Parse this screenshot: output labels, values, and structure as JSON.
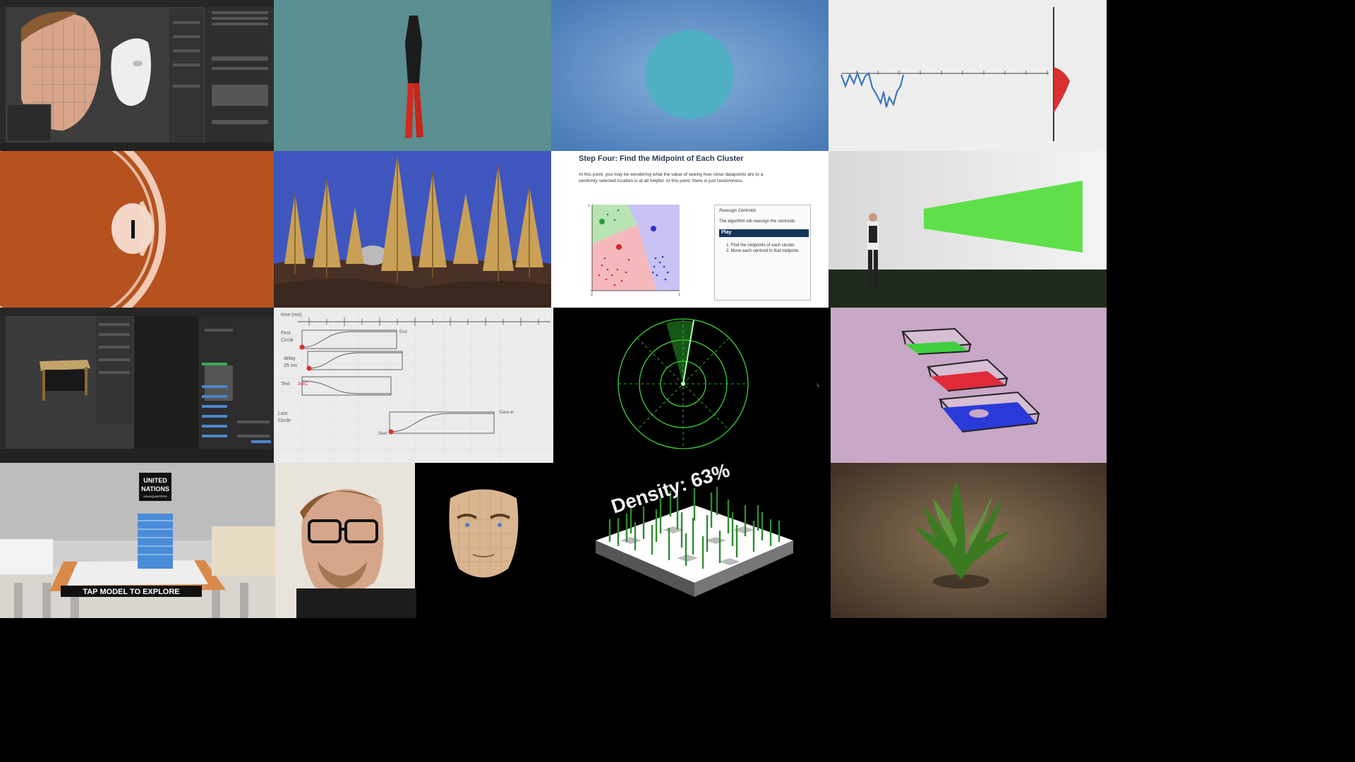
{
  "tiles": [
    {
      "id": "blender-face",
      "kind": "blender editor"
    },
    {
      "id": "pliers",
      "kind": "3d render"
    },
    {
      "id": "blue-circle",
      "kind": "render"
    },
    {
      "id": "line-plot",
      "kind": "plot"
    },
    {
      "id": "eye-diagram",
      "kind": "illustration"
    },
    {
      "id": "forest",
      "kind": "3d render"
    },
    {
      "id": "kmeans",
      "kind": "article"
    },
    {
      "id": "person-cone",
      "kind": "3d render"
    },
    {
      "id": "blender-table",
      "kind": "blender editor"
    },
    {
      "id": "sketch",
      "kind": "hand drawn animation timing sketch"
    },
    {
      "id": "radar",
      "kind": "render"
    },
    {
      "id": "glass-layers",
      "kind": "3d render"
    },
    {
      "id": "un-model",
      "kind": "ar render"
    },
    {
      "id": "selfie-face",
      "kind": "photo"
    },
    {
      "id": "density",
      "kind": "3d render"
    },
    {
      "id": "plant",
      "kind": "3d render"
    }
  ],
  "kmeans": {
    "heading": "Step Four: Find the Midpoint of Each Cluster",
    "paragraph_line1": "At this point, you may be wondering what the value of seeing how close datapoints are to a",
    "paragraph_line2": "randomly selected location is at all helpful. At this point, there is just randomness.",
    "panel_title": "Reassign Centroids",
    "panel_text": "The algorithm will reassign the centroids.",
    "play_label": "Play",
    "step1": "1. Find the midpoints of each cluster.",
    "step2": "2. Move each centroid to that midpoint.",
    "axis_zero": "0",
    "axis_one_x": "1",
    "axis_one_y": "1"
  },
  "un": {
    "sign_line1": "UNITED",
    "sign_line2": "NATIONS",
    "sign_line3": "HEADQUARTERS",
    "banner": "TAP MODEL TO EXPLORE"
  },
  "density": {
    "label": "Density: 63%"
  },
  "sketch": {
    "label_first": "First",
    "label_circle": "Circle",
    "label_delay": "delay",
    "label_delay_ms": "25 ms",
    "label_text": "Text",
    "label_abc": "ABC",
    "label_last": "Last",
    "label_last_circle": "Circle",
    "label_ease": "Ease-in",
    "label_end": "End",
    "label_start": "Start",
    "label_time": "time (ms)"
  },
  "colors": {
    "teal_bg": "#5b8f91",
    "blue_bg": "#4a7bb8",
    "circle": "#4fb0c4",
    "eye_bg": "#b5521f",
    "forest_sky": "#3f56bf",
    "cone_green": "#5fe04a",
    "radar_green": "#3cd13c",
    "lilac_bg": "#c8a8c6",
    "plot_line": "#3a78c0",
    "plot_red": "#d83030"
  }
}
